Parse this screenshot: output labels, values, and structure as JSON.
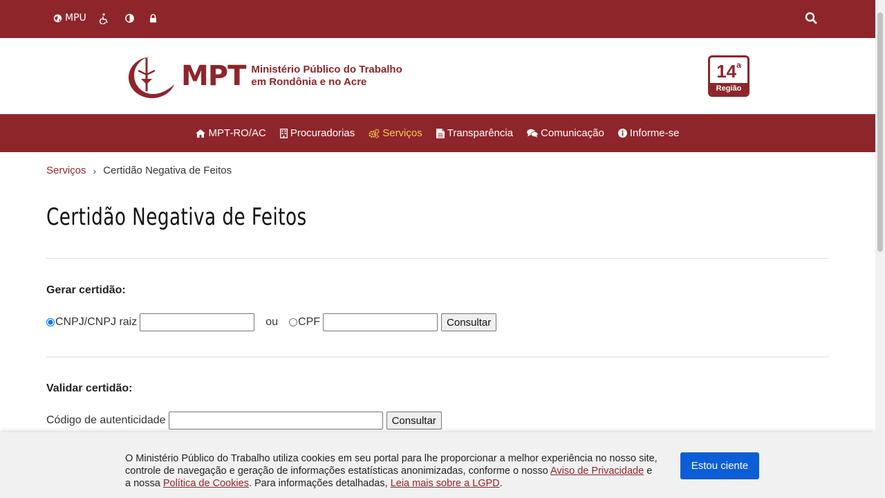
{
  "topbar": {
    "mpu_label": "MPU",
    "icons": [
      "globe-icon",
      "accessibility-icon",
      "contrast-icon",
      "lock-icon",
      "search-icon"
    ]
  },
  "header": {
    "acronym": "MPT",
    "name_line1": "Ministério Público do Trabalho",
    "name_line2": "em Rondônia e no Acre",
    "region_number": "14",
    "region_ordinal": "a",
    "region_label": "Região"
  },
  "nav": {
    "items": [
      {
        "label": "MPT-RO/AC",
        "icon": "home-icon"
      },
      {
        "label": "Procuradorias",
        "icon": "building-icon"
      },
      {
        "label": "Serviços",
        "icon": "cogs-icon",
        "active": true
      },
      {
        "label": "Transparência",
        "icon": "file-icon"
      },
      {
        "label": "Comunicação",
        "icon": "comments-icon"
      },
      {
        "label": "Informe-se",
        "icon": "info-icon"
      }
    ]
  },
  "breadcrumb": {
    "parent": "Serviços",
    "current": "Certidão Negativa de Feitos"
  },
  "page": {
    "title": "Certidão Negativa de Feitos"
  },
  "generate": {
    "heading": "Gerar certidão:",
    "radio_cnpj_label": "CNPJ/CNPJ raiz",
    "radio_cnpj_selected": true,
    "or_label": "ou",
    "radio_cpf_label": "CPF",
    "radio_cpf_selected": false,
    "cnpj_value": "",
    "cpf_value": "",
    "button_label": "Consultar"
  },
  "validate": {
    "heading": "Validar certidão:",
    "code_label": "Código de autenticidade",
    "code_value": "",
    "button_label": "Consultar"
  },
  "cookie": {
    "text_1": "O Ministério Público do Trabalho utiliza cookies em seu portal para lhe proporcionar a melhor experiência no nosso site, controle de navegação e geração de informações estatísticas anonimizadas, conforme o nosso ",
    "link_privacy": "Aviso de Privacidade",
    "text_2": " e a nossa ",
    "link_cookies": "Política de Cookies",
    "text_3": ". Para informações detalhadas, ",
    "link_lgpd": "Leia mais sobre a LGPD",
    "text_4": ".",
    "accept_label": "Estou ciente"
  },
  "colors": {
    "brand": "#8e252b",
    "nav_active": "#f5d04a",
    "accept_button": "#0b5ed7"
  }
}
